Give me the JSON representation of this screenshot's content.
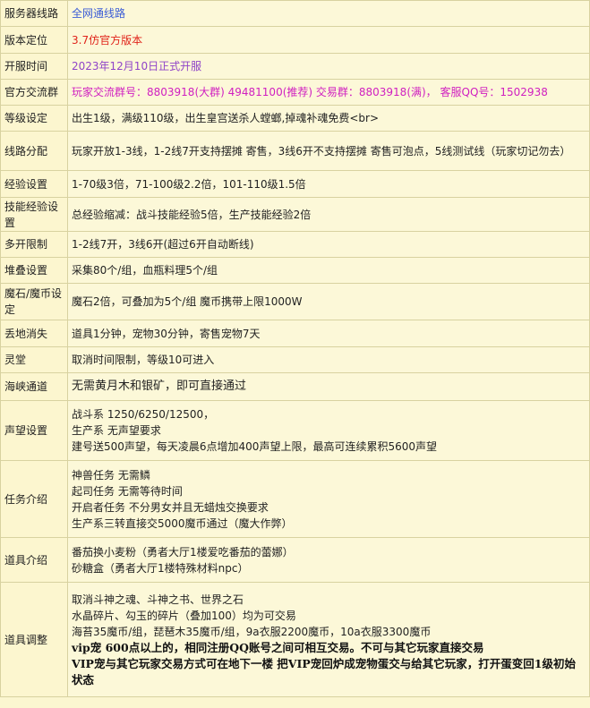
{
  "rows": [
    {
      "label": "服务器线路",
      "lines": [
        "全网通线路"
      ],
      "color": "blue"
    },
    {
      "label": "版本定位",
      "lines": [
        "3.7仿官方版本"
      ],
      "color": "red"
    },
    {
      "label": "开服时间",
      "lines": [
        "2023年12月10日正式开服"
      ],
      "color": "purple"
    },
    {
      "label": "官方交流群",
      "lines": [
        "玩家交流群号：8803918(大群) 49481100(推荐) 交易群：8803918(满)，  客服QQ号：1502938"
      ],
      "color": "magenta"
    },
    {
      "label": "等级设定",
      "lines": [
        "出生1级，满级110级，出生皇宫送杀人螳螂,掉魂补魂免费<br>"
      ]
    },
    {
      "label": "线路分配",
      "lines": [
        "玩家开放1-3线，1-2线7开支持摆摊 寄售，3线6开不支持摆摊 寄售可泡点，5线测试线（玩家切记勿去）"
      ]
    },
    {
      "label": "经验设置",
      "lines": [
        "1-70级3倍，71-100级2.2倍，101-110级1.5倍"
      ]
    },
    {
      "label": "技能经验设置",
      "lines": [
        "总经验缩减：战斗技能经验5倍，生产技能经验2倍"
      ]
    },
    {
      "label": "多开限制",
      "lines": [
        "1-2线7开，3线6开(超过6开自动断线)"
      ]
    },
    {
      "label": "堆叠设置",
      "lines": [
        "采集80个/组，血瓶料理5个/组"
      ]
    },
    {
      "label": "魔石/魔币设定",
      "lines": [
        "魔石2倍，可叠加为5个/组    魔币携带上限1000W"
      ]
    },
    {
      "label": "丢地消失",
      "lines": [
        "道具1分钟，宠物30分钟，寄售宠物7天"
      ]
    },
    {
      "label": "灵堂",
      "lines": [
        "取消时间限制，等级10可进入"
      ]
    },
    {
      "label": "海峡通道",
      "lines": [
        "无需黄月木和银矿，即可直接通过"
      ]
    },
    {
      "label": "声望设置",
      "lines": [
        "战斗系 1250/6250/12500，",
        "生产系 无声望要求",
        "建号送500声望，每天凌晨6点增加400声望上限，最高可连续累积5600声望"
      ]
    },
    {
      "label": "任务介绍",
      "lines": [
        "神兽任务  无需鳞",
        "起司任务  无需等待时间",
        "开启者任务  不分男女并且无蜡烛交换要求",
        "生产系三转直接交5000魔币通过（魔大作弊）"
      ]
    },
    {
      "label": "道具介绍",
      "lines": [
        "番茄换小麦粉（勇者大厅1楼爱吃番茄的蕾娜）",
        "砂糖盒（勇者大厅1楼特殊材料npc）"
      ]
    },
    {
      "label": "道具调整",
      "lines": [
        "取消斗神之魂、斗神之书、世界之石",
        "水晶碎片、勾玉的碎片（叠加100）均为可交易",
        "海苔35魔币/组，琵琶木35魔币/组，9a衣服2200魔币，10a衣服3300魔币"
      ],
      "bold_lines": [
        "vip宠 600点以上的，相同注册QQ账号之间可相互交易。不可与其它玩家直接交易",
        "VIP宠与其它玩家交易方式可在地下一楼 把VIP宠回炉成宠物蛋交与给其它玩家，打开蛋变回1级初始状态"
      ]
    }
  ],
  "colors": {
    "blue": "#3c5dd6",
    "red": "#e0241b",
    "purple": "#9044c8",
    "magenta": "#d020c0"
  }
}
